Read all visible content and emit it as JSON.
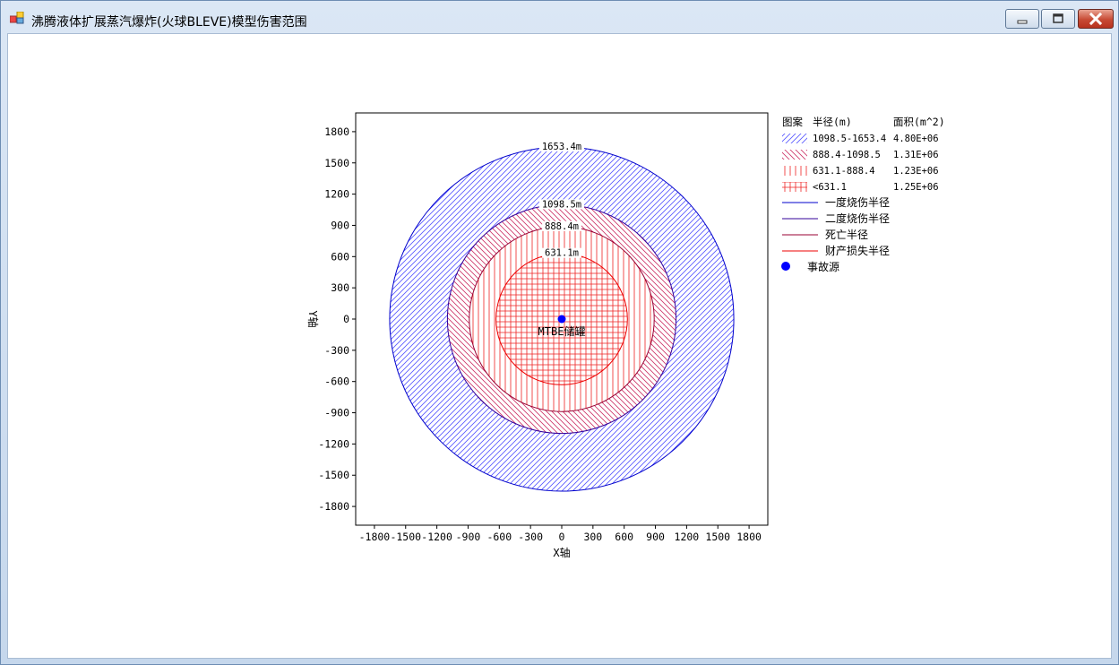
{
  "window": {
    "title": "沸腾液体扩展蒸汽爆炸(火球BLEVE)模型伤害范围",
    "controls": [
      "minimize-icon",
      "maximize-icon",
      "close-icon"
    ]
  },
  "chart_data": {
    "type": "scatter",
    "xlabel": "X轴",
    "ylabel": "Y轴",
    "xlim": [
      -1980,
      1980
    ],
    "ylim": [
      -1980,
      1980
    ],
    "xticks": [
      -1800,
      -1500,
      -1200,
      -900,
      -600,
      -300,
      0,
      300,
      600,
      900,
      1200,
      1500,
      1800
    ],
    "yticks": [
      1800,
      1500,
      1200,
      900,
      600,
      300,
      0,
      -300,
      -600,
      -900,
      -1200,
      -1500,
      -1800
    ],
    "grid": false,
    "legend_placement": "right",
    "source": {
      "name": "事故源",
      "label": "MTBE储罐",
      "x": 0,
      "y": 0,
      "color": "#0000ff"
    },
    "circles": [
      {
        "name": "一度烧伤半径",
        "radius": 1653.4,
        "label": "1653.4m",
        "color": "#0000cc"
      },
      {
        "name": "二度烧伤半径",
        "radius": 1098.5,
        "label": "1098.5m",
        "color": "#330099"
      },
      {
        "name": "死亡半径",
        "radius": 888.4,
        "label": "888.4m",
        "color": "#990033"
      },
      {
        "name": "财产损失半径",
        "radius": 631.1,
        "label": "631.1m",
        "color": "#ee0000"
      }
    ],
    "zones": [
      {
        "pattern": "diag-right",
        "range": "1098.5-1653.4",
        "area": "4.80E+06",
        "color": "#5555ff"
      },
      {
        "pattern": "diag-left",
        "range": "888.4-1098.5",
        "area": "1.31E+06",
        "color": "#cc3366"
      },
      {
        "pattern": "vertical",
        "range": "631.1-888.4",
        "area": "1.23E+06",
        "color": "#ee2222"
      },
      {
        "pattern": "grid",
        "range": "<631.1",
        "area": "1.25E+06",
        "color": "#ee2222"
      }
    ],
    "legend": {
      "header_pattern": "图案",
      "header_radius": "半径(m)",
      "header_area": "面积(m^2)"
    }
  }
}
